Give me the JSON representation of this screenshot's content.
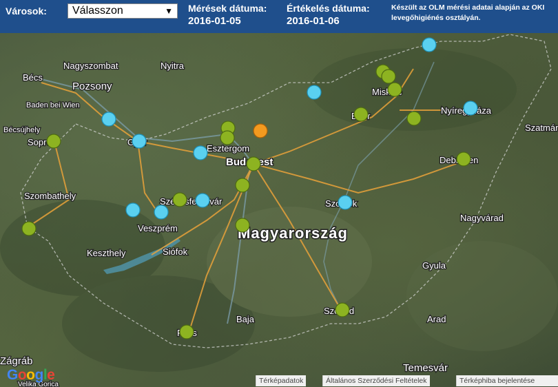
{
  "header": {
    "cities_label": "Városok:",
    "city_select_value": "Válasszon",
    "measure_date_label": "Mérések dátuma:",
    "measure_date": "2016-01-05",
    "eval_date_label": "Értékelés dátuma:",
    "eval_date": "2016-01-06",
    "note": "Készült az OLM mérési adatai alapján az OKI levegőhigiénés osztályán."
  },
  "map": {
    "country": "Magyarország",
    "cities": [
      "Bécs",
      "Pozsony",
      "Nagyszombat",
      "Nyitra",
      "Baden bei Wien",
      "Bécsújhely",
      "Sopron",
      "Győr",
      "Esztergom",
      "Budapest",
      "Székesfehérvár",
      "Veszprém",
      "Keszthely",
      "Siófok",
      "Szombathely",
      "Miskolc",
      "Eger",
      "Nyíregyháza",
      "Szatmár",
      "Debrecen",
      "Szolnok",
      "Nagyvárad",
      "Gyula",
      "Arad",
      "Szeged",
      "Baja",
      "Pécs",
      "Temesvár",
      "Zágráb",
      "Velika Gorica"
    ],
    "marker_colors": {
      "green": "#8db321",
      "blue": "#5ad0f0",
      "orange": "#f39a1f"
    }
  },
  "footer": {
    "map_data": "Térképadatok",
    "terms": "Általános Szerződési Feltételek",
    "report": "Térképhiba bejelentése",
    "logo": "Google"
  }
}
